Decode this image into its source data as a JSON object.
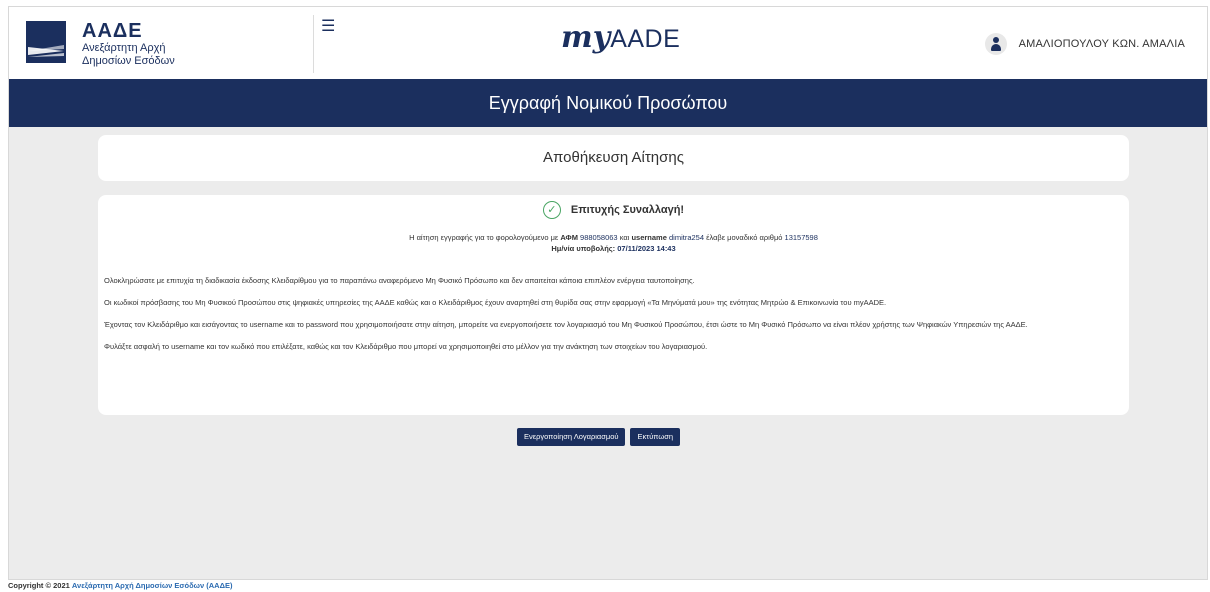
{
  "header": {
    "logo_title": "ΑΑΔΕ",
    "logo_sub1": "Ανεξάρτητη Αρχή",
    "logo_sub2": "Δημοσίων Εσόδων",
    "menu_icon": "☰",
    "brand_my": "my",
    "brand_aade": "AADE",
    "user_name": "ΑΜΑΛΙΟΠΟΥΛΟΥ ΚΩΝ. ΑΜΑΛΙΑ"
  },
  "page_title": "Εγγραφή Νομικού Προσώπου",
  "section_title": "Αποθήκευση Αίτησης",
  "success": {
    "icon": "check-circle",
    "text": "Επιτυχής Συναλλαγή!"
  },
  "info": {
    "line1_prefix": "Η αίτηση εγγραφής για το φορολογούμενο με",
    "afm_label": "ΑΦΜ",
    "afm_value": "988058063",
    "and": "και",
    "username_label": "username",
    "username_value": "dimitra254",
    "line1_suffix": "έλαβε μοναδικό αριθμό",
    "unique_number": "13157598",
    "date_label": "Ημ/νία υποβολής:",
    "date_value": "07/11/2023 14:43"
  },
  "paragraphs": [
    "Ολοκληρώσατε με επιτυχία τη διαδικασία έκδοσης Κλειδαρίθμου για το παραπάνω αναφερόμενο Μη Φυσικό Πρόσωπο και δεν απαιτείται κάποια επιπλέον ενέργεια ταυτοποίησης.",
    "Οι κωδικοί πρόσβασης του Μη Φυσικού Προσώπου στις ψηφιακές υπηρεσίες της ΑΑΔΕ καθώς και ο Κλειδάριθμος έχουν αναρτηθεί στη θυρίδα σας στην εφαρμογή «Τα Μηνύματά μου» της ενότητας Μητρώο & Επικοινωνία του myAADE.",
    "Έχοντας τον Κλειδάριθμο και εισάγοντας το username και το password που χρησιμοποιήσατε στην αίτηση, μπορείτε να ενεργοποιήσετε τον λογαριασμό του Μη Φυσικού Προσώπου, έτσι ώστε το Μη Φυσικό Πρόσωπο να είναι πλέον χρήστης των Ψηφιακών Υπηρεσιών της ΑΑΔΕ.",
    "Φυλάξτε ασφαλή το username και τον κωδικό που επιλέξατε, καθώς και τον Κλειδάριθμο που μπορεί να χρησιμοποιηθεί στο μέλλον για την ανάκτηση των στοιχείων του λογαριασμού."
  ],
  "buttons": {
    "activate": "Ενεργοποίηση Λογαριασμού",
    "print": "Εκτύπωση"
  },
  "footer": {
    "copyright": "Copyright © 2021",
    "link": "Ανεξάρτητη Αρχή Δημοσίων Εσόδων (ΑΑΔΕ)"
  },
  "colors": {
    "primary": "#1b2f5e",
    "success": "#4aa564",
    "background": "#ececec"
  }
}
